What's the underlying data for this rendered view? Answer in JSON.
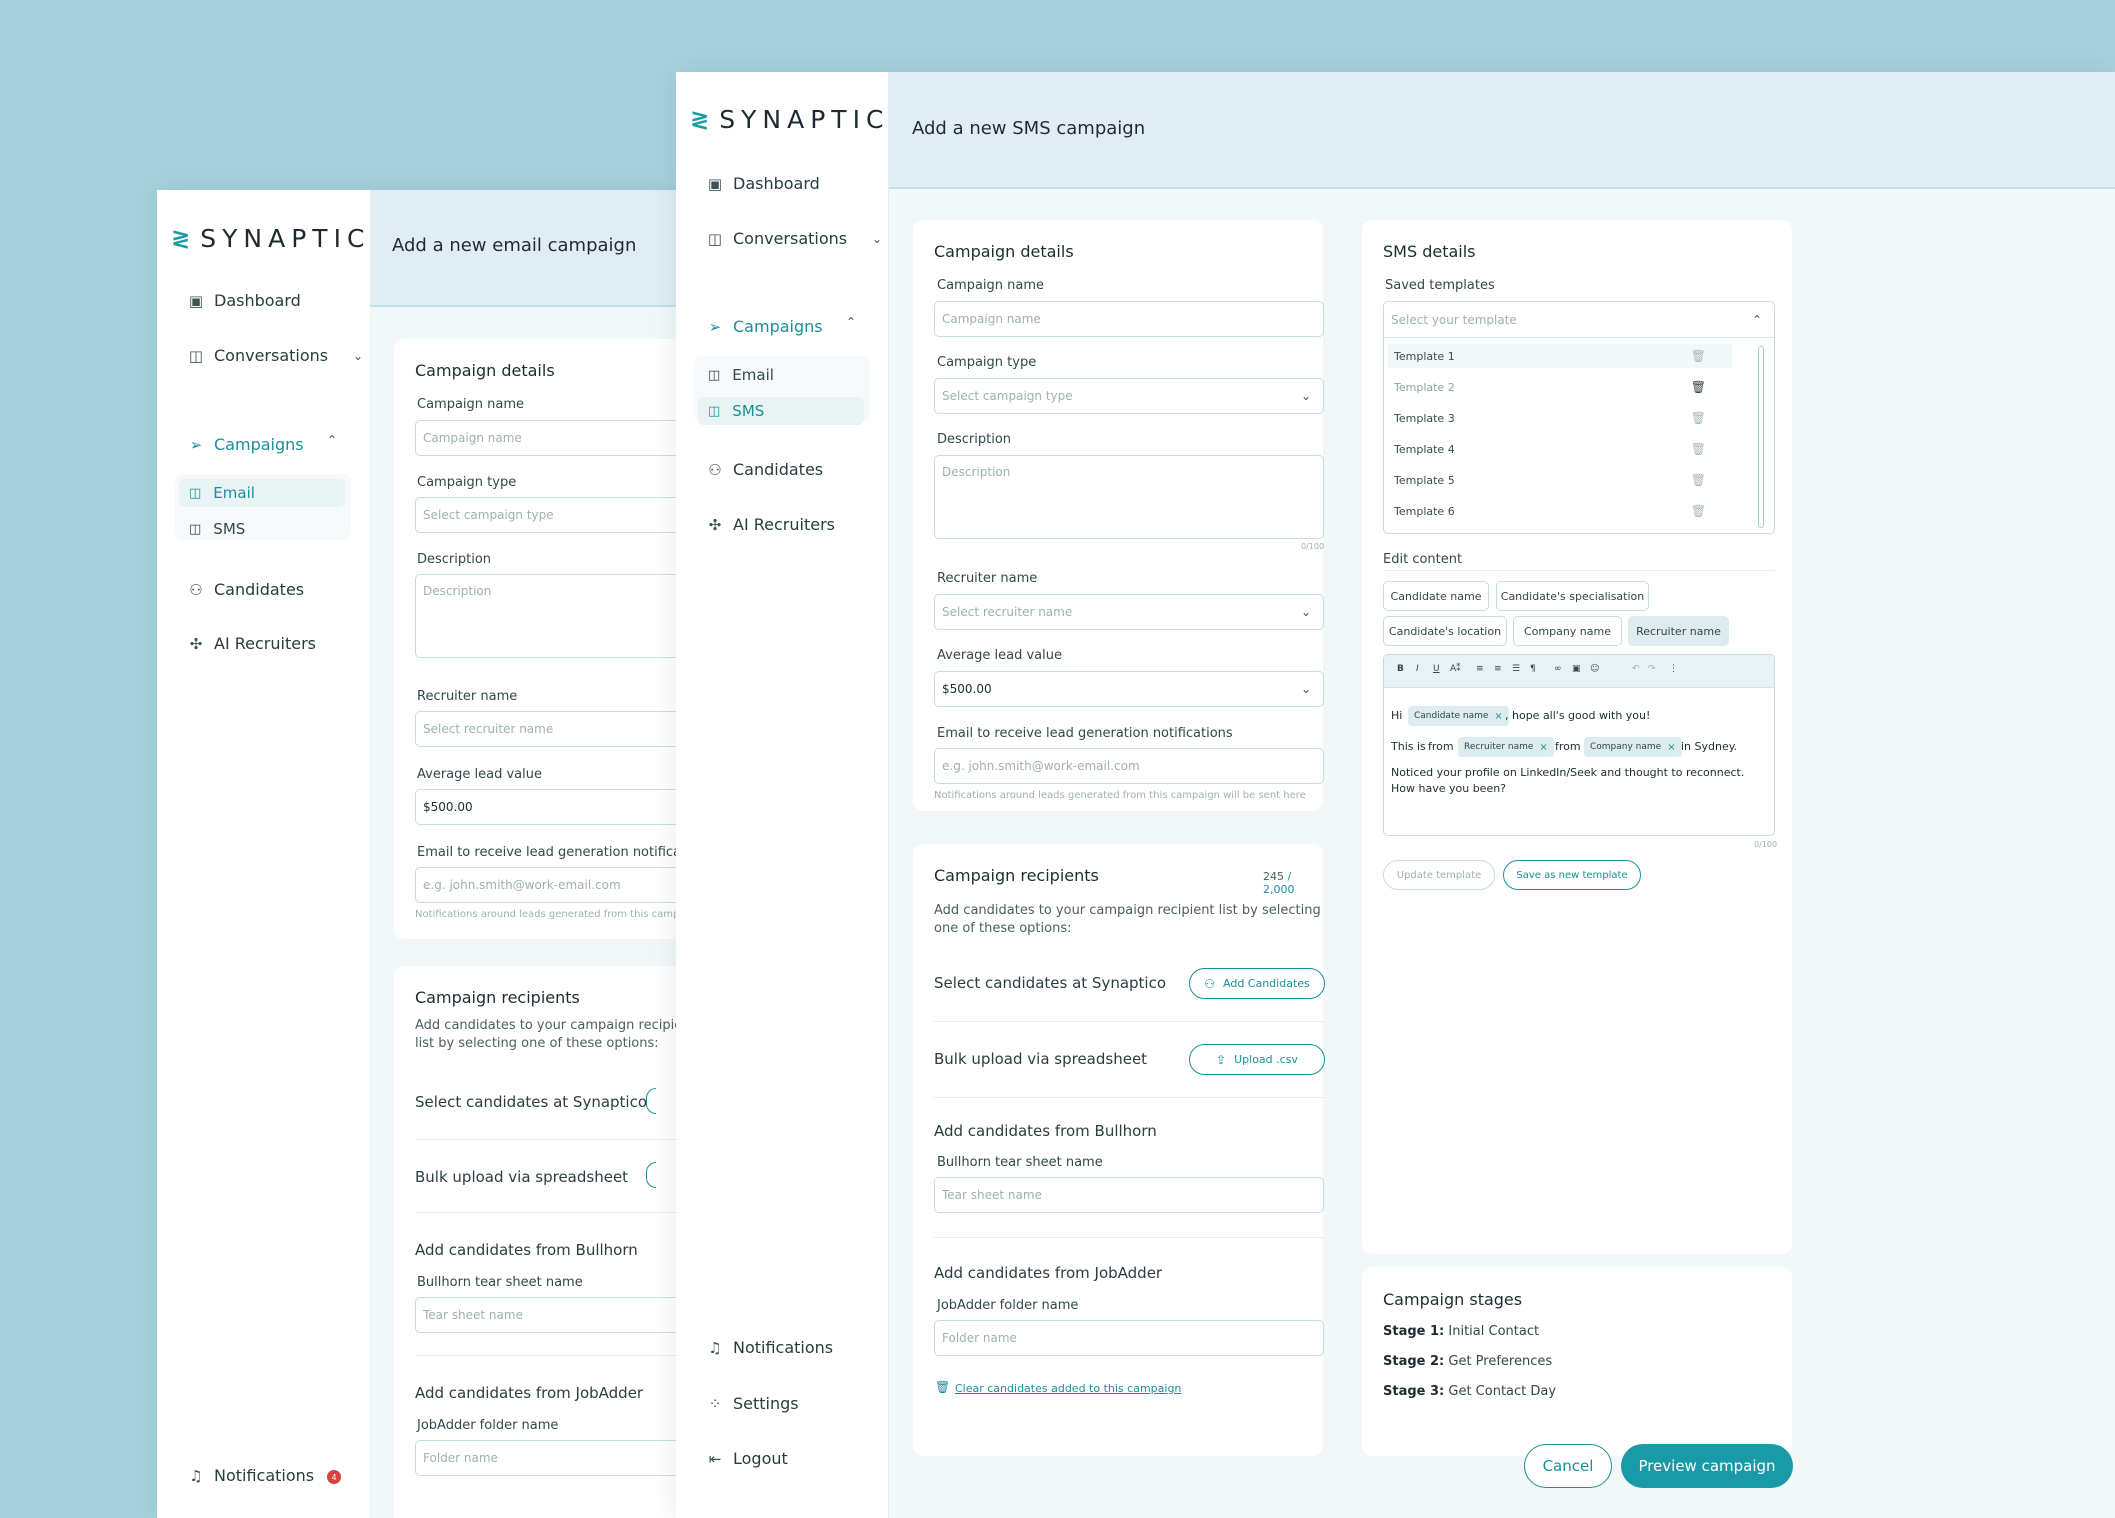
{
  "brand": {
    "logo_text": "SYNAPTICO"
  },
  "email_window": {
    "title": "Add a new email campaign",
    "nav": {
      "dashboard": "Dashboard",
      "conversations": "Conversations",
      "campaigns": "Campaigns",
      "email": "Email",
      "sms": "SMS",
      "candidates": "Candidates",
      "ai_recruiters": "AI Recruiters",
      "notifications": "Notifications",
      "notifications_count": "4"
    },
    "details": {
      "heading": "Campaign details",
      "campaign_name_label": "Campaign name",
      "campaign_name_placeholder": "Campaign name",
      "campaign_type_label": "Campaign type",
      "campaign_type_placeholder": "Select campaign type",
      "description_label": "Description",
      "description_placeholder": "Description",
      "recruiter_label": "Recruiter name",
      "recruiter_placeholder": "Select recruiter name",
      "lead_value_label": "Average lead value",
      "lead_value": "$500.00",
      "email_label": "Email to receive lead generation notifications",
      "email_placeholder": "e.g. john.smith@work-email.com",
      "email_hint": "Notifications around leads generated from this campaign will be sent here"
    },
    "recipients": {
      "heading": "Campaign recipients",
      "description": "Add candidates to your campaign recipient list by selecting one of these options:",
      "select_candidates": "Select candidates at Synaptico",
      "bulk_upload": "Bulk upload via spreadsheet",
      "bullhorn_heading": "Add candidates from Bullhorn",
      "bullhorn_label": "Bullhorn tear sheet name",
      "bullhorn_placeholder": "Tear sheet name",
      "jobadder_heading": "Add candidates from JobAdder",
      "jobadder_label": "JobAdder folder name",
      "jobadder_placeholder": "Folder name"
    }
  },
  "sms_window": {
    "title": "Add a new SMS campaign",
    "nav": {
      "dashboard": "Dashboard",
      "conversations": "Conversations",
      "campaigns": "Campaigns",
      "email": "Email",
      "sms": "SMS",
      "candidates": "Candidates",
      "ai_recruiters": "AI Recruiters",
      "notifications": "Notifications",
      "settings": "Settings",
      "logout": "Logout"
    },
    "details": {
      "heading": "Campaign details",
      "campaign_name_label": "Campaign name",
      "campaign_name_placeholder": "Campaign name",
      "campaign_type_label": "Campaign type",
      "campaign_type_placeholder": "Select campaign type",
      "description_label": "Description",
      "description_placeholder": "Description",
      "description_counter": "0/100",
      "recruiter_label": "Recruiter name",
      "recruiter_placeholder": "Select recruiter name",
      "lead_value_label": "Average lead value",
      "lead_value": "$500.00",
      "email_label": "Email to receive lead generation notifications",
      "email_placeholder": "e.g. john.smith@work-email.com",
      "email_hint": "Notifications around leads generated from this campaign will be sent here"
    },
    "recipients": {
      "heading": "Campaign recipients",
      "count_current": "245",
      "count_sep": " / ",
      "count_max": "2,000",
      "description": "Add candidates to your campaign recipient list by selecting one of these options:",
      "select_candidates": "Select candidates at Synaptico",
      "add_candidates_button": "Add Candidates",
      "bulk_upload": "Bulk upload via spreadsheet",
      "upload_button": "Upload .csv",
      "bullhorn_heading": "Add candidates from Bullhorn",
      "bullhorn_label": "Bullhorn tear sheet name",
      "bullhorn_placeholder": "Tear sheet name",
      "jobadder_heading": "Add candidates from JobAdder",
      "jobadder_label": "JobAdder folder name",
      "jobadder_placeholder": "Folder name",
      "clear_link": "Clear candidates added to this campaign"
    },
    "sms_details": {
      "heading": "SMS details",
      "saved_templates_label": "Saved templates",
      "template_placeholder": "Select your template",
      "templates": [
        "Template 1",
        "Template 2",
        "Template 3",
        "Template 4",
        "Template 5",
        "Template 6"
      ],
      "edit_content_label": "Edit content",
      "chips": [
        "Candidate name",
        "Candidate's specialisation",
        "Candidate's location",
        "Company name",
        "Recruiter name"
      ],
      "editor": {
        "hi": "Hi",
        "tag_candidate": "Candidate name",
        "after_candidate": ", hope all's good with you!",
        "this_is": "This is",
        "from1": "from",
        "tag_recruiter": "Recruiter name",
        "from2": "from",
        "tag_company": "Company name",
        "in_sydney": "in Sydney.",
        "body": "Noticed your profile on LinkedIn/Seek and thought to reconnect. How have you been?",
        "counter": "0/100"
      },
      "update_template_button": "Update template",
      "save_template_button": "Save as new template"
    },
    "stages": {
      "heading": "Campaign stages",
      "items": [
        {
          "label": "Stage 1:",
          "value": " Initial Contact"
        },
        {
          "label": "Stage 2:",
          "value": " Get Preferences"
        },
        {
          "label": "Stage 3:",
          "value": " Get Contact Day"
        }
      ]
    },
    "actions": {
      "cancel": "Cancel",
      "preview": "Preview  campaign"
    }
  },
  "icons": {
    "logo": "synaptico-logo-icon",
    "dashboard": "dashboard-icon",
    "conversations": "chat-icon",
    "campaigns": "paper-plane-icon",
    "candidates": "people-icon",
    "ai_recruiters": "robot-icon",
    "notifications": "bell-icon",
    "settings": "grid-icon",
    "logout": "logout-icon",
    "trash": "trash-icon",
    "upload": "upload-icon"
  },
  "colors": {
    "accent": "#1a9aa6",
    "background": "#a6d2dd",
    "badge": "#d9433f"
  }
}
